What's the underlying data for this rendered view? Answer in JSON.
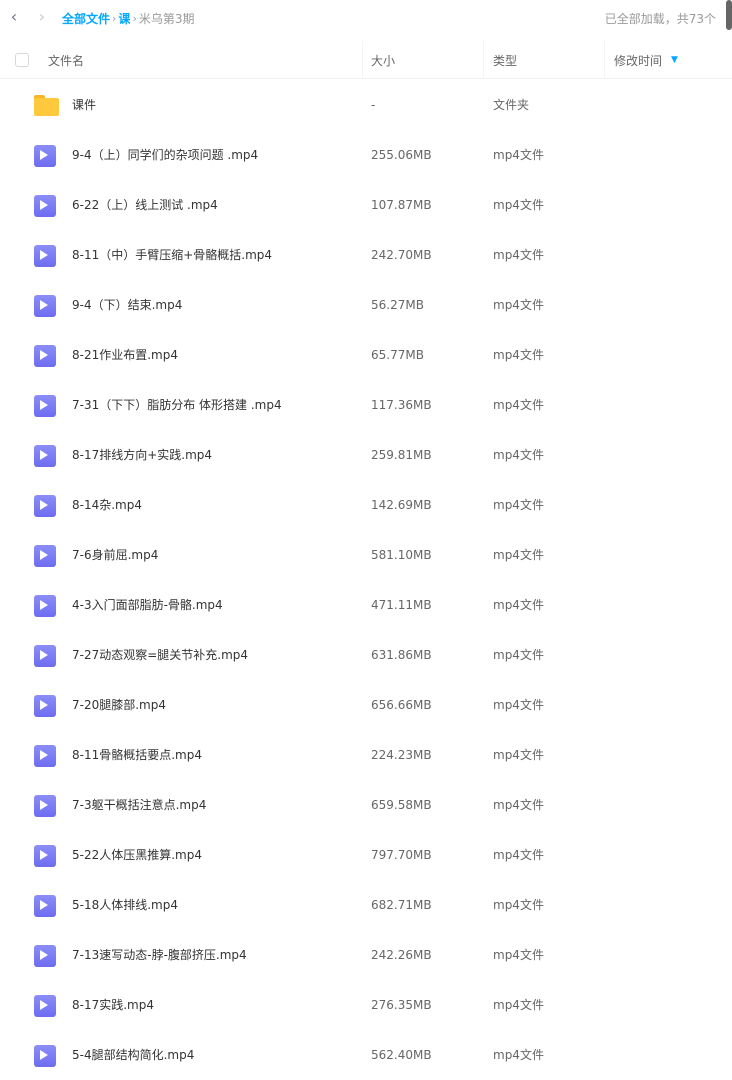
{
  "nav": {
    "back_icon": "chevron-left-icon",
    "forward_icon": "chevron-right-icon"
  },
  "breadcrumb": {
    "root": "全部文件",
    "level1": "课",
    "current": "米乌第3期",
    "separator": "›"
  },
  "status": {
    "loaded_text": "已全部加载，共73个"
  },
  "table": {
    "headers": {
      "name": "文件名",
      "size": "大小",
      "type": "类型",
      "modified": "修改时间",
      "sort_icon": "sort-down-icon"
    },
    "rows": [
      {
        "name": "课件",
        "size": "-",
        "type": "文件夹",
        "icon": "folder-icon"
      },
      {
        "name": "9-4（上）同学们的杂项问题 .mp4",
        "size": "255.06MB",
        "type": "mp4文件",
        "icon": "video-file-icon"
      },
      {
        "name": "6-22（上）线上测试 .mp4",
        "size": "107.87MB",
        "type": "mp4文件",
        "icon": "video-file-icon"
      },
      {
        "name": "8-11（中）手臂压缩+骨骼概括.mp4",
        "size": "242.70MB",
        "type": "mp4文件",
        "icon": "video-file-icon"
      },
      {
        "name": "9-4（下）结束.mp4",
        "size": "56.27MB",
        "type": "mp4文件",
        "icon": "video-file-icon"
      },
      {
        "name": "8-21作业布置.mp4",
        "size": "65.77MB",
        "type": "mp4文件",
        "icon": "video-file-icon"
      },
      {
        "name": "7-31（下下）脂肪分布 体形搭建 .mp4",
        "size": "117.36MB",
        "type": "mp4文件",
        "icon": "video-file-icon"
      },
      {
        "name": "8-17排线方向+实践.mp4",
        "size": "259.81MB",
        "type": "mp4文件",
        "icon": "video-file-icon"
      },
      {
        "name": "8-14杂.mp4",
        "size": "142.69MB",
        "type": "mp4文件",
        "icon": "video-file-icon"
      },
      {
        "name": "7-6身前屈.mp4",
        "size": "581.10MB",
        "type": "mp4文件",
        "icon": "video-file-icon"
      },
      {
        "name": "4-3入门面部脂肪-骨骼.mp4",
        "size": "471.11MB",
        "type": "mp4文件",
        "icon": "video-file-icon"
      },
      {
        "name": "7-27动态观察=腿关节补充.mp4",
        "size": "631.86MB",
        "type": "mp4文件",
        "icon": "video-file-icon"
      },
      {
        "name": "7-20腿膝部.mp4",
        "size": "656.66MB",
        "type": "mp4文件",
        "icon": "video-file-icon"
      },
      {
        "name": "8-11骨骼概括要点.mp4",
        "size": "224.23MB",
        "type": "mp4文件",
        "icon": "video-file-icon"
      },
      {
        "name": "7-3躯干概括注意点.mp4",
        "size": "659.58MB",
        "type": "mp4文件",
        "icon": "video-file-icon"
      },
      {
        "name": "5-22人体压黑推算.mp4",
        "size": "797.70MB",
        "type": "mp4文件",
        "icon": "video-file-icon"
      },
      {
        "name": "5-18人体排线.mp4",
        "size": "682.71MB",
        "type": "mp4文件",
        "icon": "video-file-icon"
      },
      {
        "name": "7-13速写动态-脖-腹部挤压.mp4",
        "size": "242.26MB",
        "type": "mp4文件",
        "icon": "video-file-icon"
      },
      {
        "name": "8-17实践.mp4",
        "size": "276.35MB",
        "type": "mp4文件",
        "icon": "video-file-icon"
      },
      {
        "name": "5-4腿部结构简化.mp4",
        "size": "562.40MB",
        "type": "mp4文件",
        "icon": "video-file-icon"
      }
    ]
  },
  "colors": {
    "accent": "#06a7ff",
    "video_icon": "#7a7cf4",
    "folder_icon": "#ffc93d"
  }
}
